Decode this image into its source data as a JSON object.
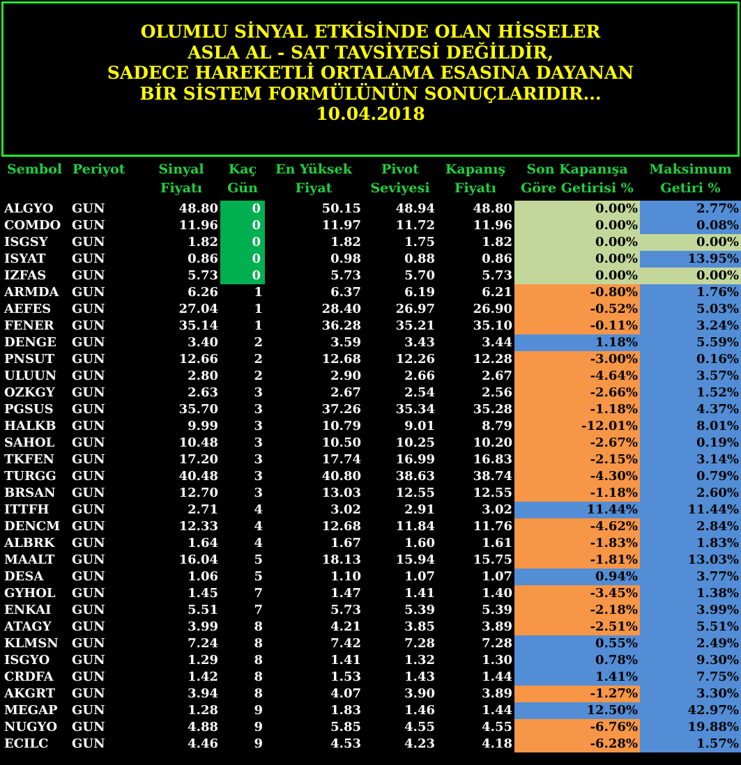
{
  "banner": {
    "line1": "OLUMLU SİNYAL ETKİSİNDE OLAN HİSSELER",
    "line2": "ASLA AL - SAT TAVSİYESİ DEĞİLDİR,",
    "line3": "SADECE HAREKETLİ ORTALAMA ESASINA DAYANAN",
    "line4": "BİR SİSTEM FORMÜLÜNÜN SONUÇLARIDIR...",
    "date": "10.04.2018"
  },
  "headers": {
    "sembol": "Sembol",
    "periyot": "Periyot",
    "sinyal_1": "Sinyal",
    "sinyal_2": "Fiyatı",
    "kacgun_1": "Kaç",
    "kacgun_2": "Gün",
    "enyuksek_1": "En Yüksek",
    "enyuksek_2": "Fiyat",
    "pivot_1": "Pivot",
    "pivot_2": "Seviyesi",
    "kapanis_1": "Kapanış",
    "kapanis_2": "Fiyatı",
    "sonkap_1": "Son Kapanışa",
    "sonkap_2": "Göre Getirisi %",
    "maks_1": "Maksimum",
    "maks_2": "Getiri %"
  },
  "colors": {
    "green": "#00b050",
    "light_green": "#c4d79b",
    "orange": "#f79646",
    "blue": "#538dd5",
    "header_text": "#1ed13d",
    "banner_text": "#ffff00"
  },
  "rows": [
    {
      "symbol": "ALGYO",
      "period": "GUN",
      "signal": "48.80",
      "days": "0",
      "high": "50.15",
      "pivot": "48.94",
      "close": "48.80",
      "last": "0.00%",
      "max": "2.77%",
      "last_color": "light_green",
      "max_color": "blue"
    },
    {
      "symbol": "COMDO",
      "period": "GUN",
      "signal": "11.96",
      "days": "0",
      "high": "11.97",
      "pivot": "11.72",
      "close": "11.96",
      "last": "0.00%",
      "max": "0.08%",
      "last_color": "light_green",
      "max_color": "blue"
    },
    {
      "symbol": "ISGSY",
      "period": "GUN",
      "signal": "1.82",
      "days": "0",
      "high": "1.82",
      "pivot": "1.75",
      "close": "1.82",
      "last": "0.00%",
      "max": "0.00%",
      "last_color": "light_green",
      "max_color": "light_green"
    },
    {
      "symbol": "ISYAT",
      "period": "GUN",
      "signal": "0.86",
      "days": "0",
      "high": "0.98",
      "pivot": "0.88",
      "close": "0.86",
      "last": "0.00%",
      "max": "13.95%",
      "last_color": "light_green",
      "max_color": "blue"
    },
    {
      "symbol": "IZFAS",
      "period": "GUN",
      "signal": "5.73",
      "days": "0",
      "high": "5.73",
      "pivot": "5.70",
      "close": "5.73",
      "last": "0.00%",
      "max": "0.00%",
      "last_color": "light_green",
      "max_color": "light_green"
    },
    {
      "symbol": "ARMDA",
      "period": "GUN",
      "signal": "6.26",
      "days": "1",
      "high": "6.37",
      "pivot": "6.19",
      "close": "6.21",
      "last": "-0.80%",
      "max": "1.76%",
      "last_color": "orange",
      "max_color": "blue"
    },
    {
      "symbol": "AEFES",
      "period": "GUN",
      "signal": "27.04",
      "days": "1",
      "high": "28.40",
      "pivot": "26.97",
      "close": "26.90",
      "last": "-0.52%",
      "max": "5.03%",
      "last_color": "orange",
      "max_color": "blue"
    },
    {
      "symbol": "FENER",
      "period": "GUN",
      "signal": "35.14",
      "days": "1",
      "high": "36.28",
      "pivot": "35.21",
      "close": "35.10",
      "last": "-0.11%",
      "max": "3.24%",
      "last_color": "orange",
      "max_color": "blue"
    },
    {
      "symbol": "DENGE",
      "period": "GUN",
      "signal": "3.40",
      "days": "2",
      "high": "3.59",
      "pivot": "3.43",
      "close": "3.44",
      "last": "1.18%",
      "max": "5.59%",
      "last_color": "blue",
      "max_color": "blue"
    },
    {
      "symbol": "PNSUT",
      "period": "GUN",
      "signal": "12.66",
      "days": "2",
      "high": "12.68",
      "pivot": "12.26",
      "close": "12.28",
      "last": "-3.00%",
      "max": "0.16%",
      "last_color": "orange",
      "max_color": "blue"
    },
    {
      "symbol": "ULUUN",
      "period": "GUN",
      "signal": "2.80",
      "days": "2",
      "high": "2.90",
      "pivot": "2.66",
      "close": "2.67",
      "last": "-4.64%",
      "max": "3.57%",
      "last_color": "orange",
      "max_color": "blue"
    },
    {
      "symbol": "OZKGY",
      "period": "GUN",
      "signal": "2.63",
      "days": "3",
      "high": "2.67",
      "pivot": "2.54",
      "close": "2.56",
      "last": "-2.66%",
      "max": "1.52%",
      "last_color": "orange",
      "max_color": "blue"
    },
    {
      "symbol": "PGSUS",
      "period": "GUN",
      "signal": "35.70",
      "days": "3",
      "high": "37.26",
      "pivot": "35.34",
      "close": "35.28",
      "last": "-1.18%",
      "max": "4.37%",
      "last_color": "orange",
      "max_color": "blue"
    },
    {
      "symbol": "HALKB",
      "period": "GUN",
      "signal": "9.99",
      "days": "3",
      "high": "10.79",
      "pivot": "9.01",
      "close": "8.79",
      "last": "-12.01%",
      "max": "8.01%",
      "last_color": "orange",
      "max_color": "blue"
    },
    {
      "symbol": "SAHOL",
      "period": "GUN",
      "signal": "10.48",
      "days": "3",
      "high": "10.50",
      "pivot": "10.25",
      "close": "10.20",
      "last": "-2.67%",
      "max": "0.19%",
      "last_color": "orange",
      "max_color": "blue"
    },
    {
      "symbol": "TKFEN",
      "period": "GUN",
      "signal": "17.20",
      "days": "3",
      "high": "17.74",
      "pivot": "16.99",
      "close": "16.83",
      "last": "-2.15%",
      "max": "3.14%",
      "last_color": "orange",
      "max_color": "blue"
    },
    {
      "symbol": "TURGG",
      "period": "GUN",
      "signal": "40.48",
      "days": "3",
      "high": "40.80",
      "pivot": "38.63",
      "close": "38.74",
      "last": "-4.30%",
      "max": "0.79%",
      "last_color": "orange",
      "max_color": "blue"
    },
    {
      "symbol": "BRSAN",
      "period": "GUN",
      "signal": "12.70",
      "days": "3",
      "high": "13.03",
      "pivot": "12.55",
      "close": "12.55",
      "last": "-1.18%",
      "max": "2.60%",
      "last_color": "orange",
      "max_color": "blue"
    },
    {
      "symbol": "ITTFH",
      "period": "GUN",
      "signal": "2.71",
      "days": "4",
      "high": "3.02",
      "pivot": "2.91",
      "close": "3.02",
      "last": "11.44%",
      "max": "11.44%",
      "last_color": "blue",
      "max_color": "blue"
    },
    {
      "symbol": "DENCM",
      "period": "GUN",
      "signal": "12.33",
      "days": "4",
      "high": "12.68",
      "pivot": "11.84",
      "close": "11.76",
      "last": "-4.62%",
      "max": "2.84%",
      "last_color": "orange",
      "max_color": "blue"
    },
    {
      "symbol": "ALBRK",
      "period": "GUN",
      "signal": "1.64",
      "days": "4",
      "high": "1.67",
      "pivot": "1.60",
      "close": "1.61",
      "last": "-1.83%",
      "max": "1.83%",
      "last_color": "orange",
      "max_color": "blue"
    },
    {
      "symbol": "MAALT",
      "period": "GUN",
      "signal": "16.04",
      "days": "5",
      "high": "18.13",
      "pivot": "15.94",
      "close": "15.75",
      "last": "-1.81%",
      "max": "13.03%",
      "last_color": "orange",
      "max_color": "blue"
    },
    {
      "symbol": "DESA",
      "period": "GUN",
      "signal": "1.06",
      "days": "5",
      "high": "1.10",
      "pivot": "1.07",
      "close": "1.07",
      "last": "0.94%",
      "max": "3.77%",
      "last_color": "blue",
      "max_color": "blue"
    },
    {
      "symbol": "GYHOL",
      "period": "GUN",
      "signal": "1.45",
      "days": "7",
      "high": "1.47",
      "pivot": "1.41",
      "close": "1.40",
      "last": "-3.45%",
      "max": "1.38%",
      "last_color": "orange",
      "max_color": "blue"
    },
    {
      "symbol": "ENKAI",
      "period": "GUN",
      "signal": "5.51",
      "days": "7",
      "high": "5.73",
      "pivot": "5.39",
      "close": "5.39",
      "last": "-2.18%",
      "max": "3.99%",
      "last_color": "orange",
      "max_color": "blue"
    },
    {
      "symbol": "ATAGY",
      "period": "GUN",
      "signal": "3.99",
      "days": "8",
      "high": "4.21",
      "pivot": "3.85",
      "close": "3.89",
      "last": "-2.51%",
      "max": "5.51%",
      "last_color": "orange",
      "max_color": "blue"
    },
    {
      "symbol": "KLMSN",
      "period": "GUN",
      "signal": "7.24",
      "days": "8",
      "high": "7.42",
      "pivot": "7.28",
      "close": "7.28",
      "last": "0.55%",
      "max": "2.49%",
      "last_color": "blue",
      "max_color": "blue"
    },
    {
      "symbol": "ISGYO",
      "period": "GUN",
      "signal": "1.29",
      "days": "8",
      "high": "1.41",
      "pivot": "1.32",
      "close": "1.30",
      "last": "0.78%",
      "max": "9.30%",
      "last_color": "blue",
      "max_color": "blue"
    },
    {
      "symbol": "CRDFA",
      "period": "GUN",
      "signal": "1.42",
      "days": "8",
      "high": "1.53",
      "pivot": "1.43",
      "close": "1.44",
      "last": "1.41%",
      "max": "7.75%",
      "last_color": "blue",
      "max_color": "blue"
    },
    {
      "symbol": "AKGRT",
      "period": "GUN",
      "signal": "3.94",
      "days": "8",
      "high": "4.07",
      "pivot": "3.90",
      "close": "3.89",
      "last": "-1.27%",
      "max": "3.30%",
      "last_color": "orange",
      "max_color": "blue"
    },
    {
      "symbol": "MEGAP",
      "period": "GUN",
      "signal": "1.28",
      "days": "9",
      "high": "1.83",
      "pivot": "1.46",
      "close": "1.44",
      "last": "12.50%",
      "max": "42.97%",
      "last_color": "blue",
      "max_color": "blue"
    },
    {
      "symbol": "NUGYO",
      "period": "GUN",
      "signal": "4.88",
      "days": "9",
      "high": "5.85",
      "pivot": "4.55",
      "close": "4.55",
      "last": "-6.76%",
      "max": "19.88%",
      "last_color": "orange",
      "max_color": "blue"
    },
    {
      "symbol": "ECILC",
      "period": "GUN",
      "signal": "4.46",
      "days": "9",
      "high": "4.53",
      "pivot": "4.23",
      "close": "4.18",
      "last": "-6.28%",
      "max": "1.57%",
      "last_color": "orange",
      "max_color": "blue"
    }
  ]
}
